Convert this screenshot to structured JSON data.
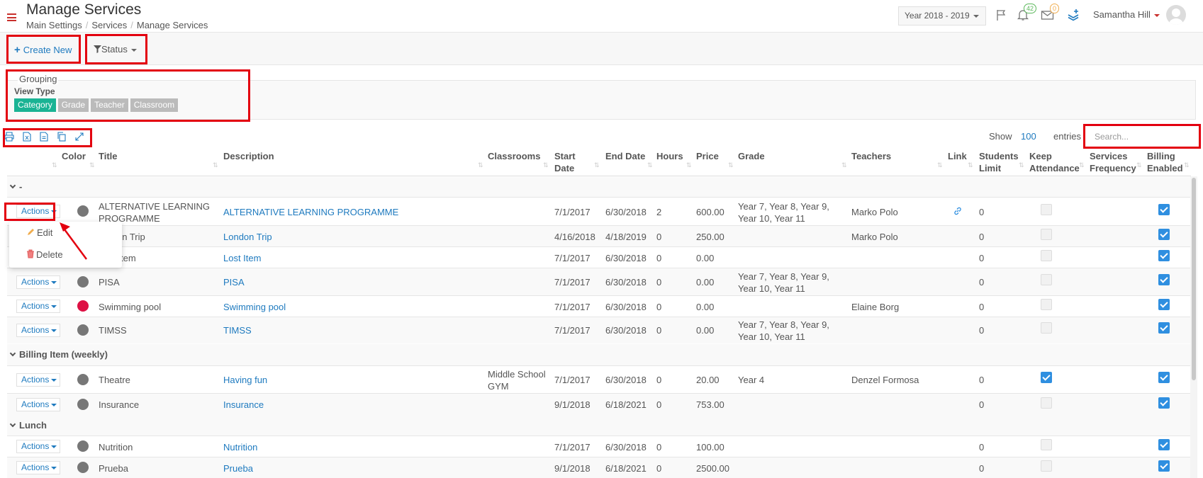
{
  "header": {
    "title": "Manage Services",
    "breadcrumbs": [
      "Main Settings",
      "Services",
      "Manage Services"
    ],
    "year_selector": "Year 2018 - 2019",
    "notifications_count": "42",
    "messages_count": "0",
    "user_name": "Samantha Hill"
  },
  "toolbar": {
    "create_label": "Create New",
    "status_label": "Status"
  },
  "grouping": {
    "legend": "Grouping",
    "view_type_label": "View Type",
    "view_types": [
      "Category",
      "Grade",
      "Teacher",
      "Classroom"
    ],
    "active_view_type": "Category"
  },
  "table_controls": {
    "show_label": "Show",
    "entries_value": "100",
    "entries_label": "entries",
    "search_placeholder": "Search..."
  },
  "table": {
    "columns": {
      "color": "Color",
      "title": "Title",
      "description": "Description",
      "classrooms": "Classrooms",
      "start_date_1": "Start",
      "start_date_2": "Date",
      "end_date": "End Date",
      "hours": "Hours",
      "price": "Price",
      "grade": "Grade",
      "teachers": "Teachers",
      "link": "Link",
      "students_limit_1": "Students",
      "students_limit_2": "Limit",
      "keep_attendance_1": "Keep",
      "keep_attendance_2": "Attendance",
      "services_frequency_1": "Services",
      "services_frequency_2": "Frequency",
      "billing_enabled_1": "Billing",
      "billing_enabled_2": "Enabled"
    },
    "actions_label": "Actions",
    "groups": {
      "g1": "-",
      "g2": "Billing Item (weekly)",
      "g3": "Lunch"
    },
    "rows": [
      {
        "title_1": "ALTERNATIVE LEARNING",
        "title_2": "PROGRAMME",
        "description": "ALTERNATIVE LEARNING PROGRAMME",
        "classrooms": "",
        "start": "7/1/2017",
        "end": "6/30/2018",
        "hours": "2",
        "price": "600.00",
        "grade_1": "Year 7, Year 8, Year 9,",
        "grade_2": "Year 10, Year 11",
        "teachers": "Marko Polo",
        "students_limit": "0",
        "color": "#777777"
      },
      {
        "title": "London Trip",
        "title_visible": "on Trip",
        "description": "London Trip",
        "start": "4/16/2018",
        "end": "4/18/2019",
        "hours": "0",
        "price": "250.00",
        "grade": "",
        "teachers": "Marko Polo",
        "students_limit": "0",
        "color": "#777777"
      },
      {
        "title": "Lost Item",
        "title_visible": "tem",
        "description": "Lost Item",
        "start": "7/1/2017",
        "end": "6/30/2018",
        "hours": "0",
        "price": "0.00",
        "grade": "",
        "teachers": "",
        "students_limit": "0",
        "color": "#777777"
      },
      {
        "title": "PISA",
        "description": "PISA",
        "start": "7/1/2017",
        "end": "6/30/2018",
        "hours": "0",
        "price": "0.00",
        "grade_1": "Year 7, Year 8, Year 9,",
        "grade_2": "Year 10, Year 11",
        "teachers": "",
        "students_limit": "0",
        "color": "#777777"
      },
      {
        "title": "Swimming pool",
        "description": "Swimming pool",
        "start": "7/1/2017",
        "end": "6/30/2018",
        "hours": "0",
        "price": "0.00",
        "grade": "",
        "teachers": "Elaine Borg",
        "students_limit": "0",
        "color": "#dd1144"
      },
      {
        "title": "TIMSS",
        "description": "TIMSS",
        "start": "7/1/2017",
        "end": "6/30/2018",
        "hours": "0",
        "price": "0.00",
        "grade_1": "Year 7, Year 8, Year 9,",
        "grade_2": "Year 10, Year 11",
        "teachers": "",
        "students_limit": "0",
        "color": "#777777"
      },
      {
        "title": "Theatre",
        "description": "Having fun",
        "classrooms_1": "Middle School",
        "classrooms_2": "GYM",
        "start": "7/1/2017",
        "end": "6/30/2018",
        "hours": "0",
        "price": "20.00",
        "grade": "Year 4",
        "teachers": "Denzel Formosa",
        "students_limit": "0",
        "color": "#777777"
      },
      {
        "title": "Insurance",
        "description": "Insurance",
        "start": "9/1/2018",
        "end": "6/18/2021",
        "hours": "0",
        "price": "753.00",
        "grade": "",
        "teachers": "",
        "students_limit": "0",
        "color": "#777777"
      },
      {
        "title": "Nutrition",
        "description": "Nutrition",
        "start": "7/1/2017",
        "end": "6/30/2018",
        "hours": "0",
        "price": "100.00",
        "grade": "",
        "teachers": "",
        "students_limit": "0",
        "color": "#777777"
      },
      {
        "title": "Prueba",
        "description": "Prueba",
        "start": "9/1/2018",
        "end": "6/18/2021",
        "hours": "0",
        "price": "2500.00",
        "grade": "",
        "teachers": "",
        "students_limit": "0",
        "color": "#777777"
      }
    ]
  },
  "actions_menu": {
    "edit_label": "Edit",
    "delete_label": "Delete"
  },
  "colors": {
    "accent": "#1e7abf",
    "active_view": "#1ab394",
    "annotation": "#e3000f",
    "checkbox_on": "#2f8fe0"
  }
}
